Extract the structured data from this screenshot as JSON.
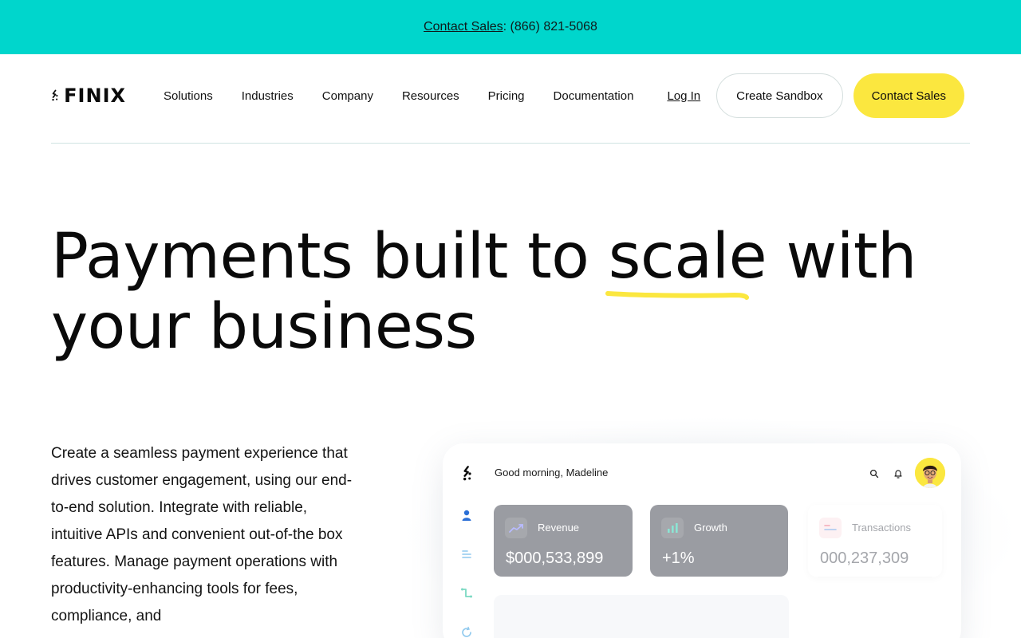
{
  "topbar": {
    "link": "Contact Sales",
    "phone": ": (866) 821-5068"
  },
  "nav": {
    "logo": "FINIX",
    "links": [
      "Solutions",
      "Industries",
      "Company",
      "Resources",
      "Pricing",
      "Documentation"
    ],
    "login": "Log In",
    "sandbox": "Create Sandbox",
    "contact": "Contact Sales"
  },
  "hero": {
    "title_pre": "Payments built to ",
    "title_hl": "scale",
    "title_post": " with your business",
    "highlight_color": "#fbe73f",
    "description": "Create a seamless payment experience that drives customer engagement, using our end-to-end solution. Integrate with reliable, intuitive APIs and convenient out-of-the box features. Manage payment operations with productivity-enhancing tools for fees, compliance, and"
  },
  "dashboard": {
    "greeting": "Good morning, Madeline",
    "cards": [
      {
        "label": "Revenue",
        "value": "$000,533,899"
      },
      {
        "label": "Growth",
        "value": "+1%"
      },
      {
        "label": "Transactions",
        "value": "000,237,309"
      }
    ]
  },
  "colors": {
    "topbar": "#00d6cc",
    "accent_yellow": "#fbe73f",
    "card_gray": "#9a9ca2"
  },
  "icons": [
    "finix-logo-icon",
    "search-icon",
    "bell-icon",
    "user-icon",
    "list-icon",
    "route-icon",
    "refresh-icon",
    "chart-up-icon",
    "bar-chart-icon",
    "transactions-icon"
  ]
}
